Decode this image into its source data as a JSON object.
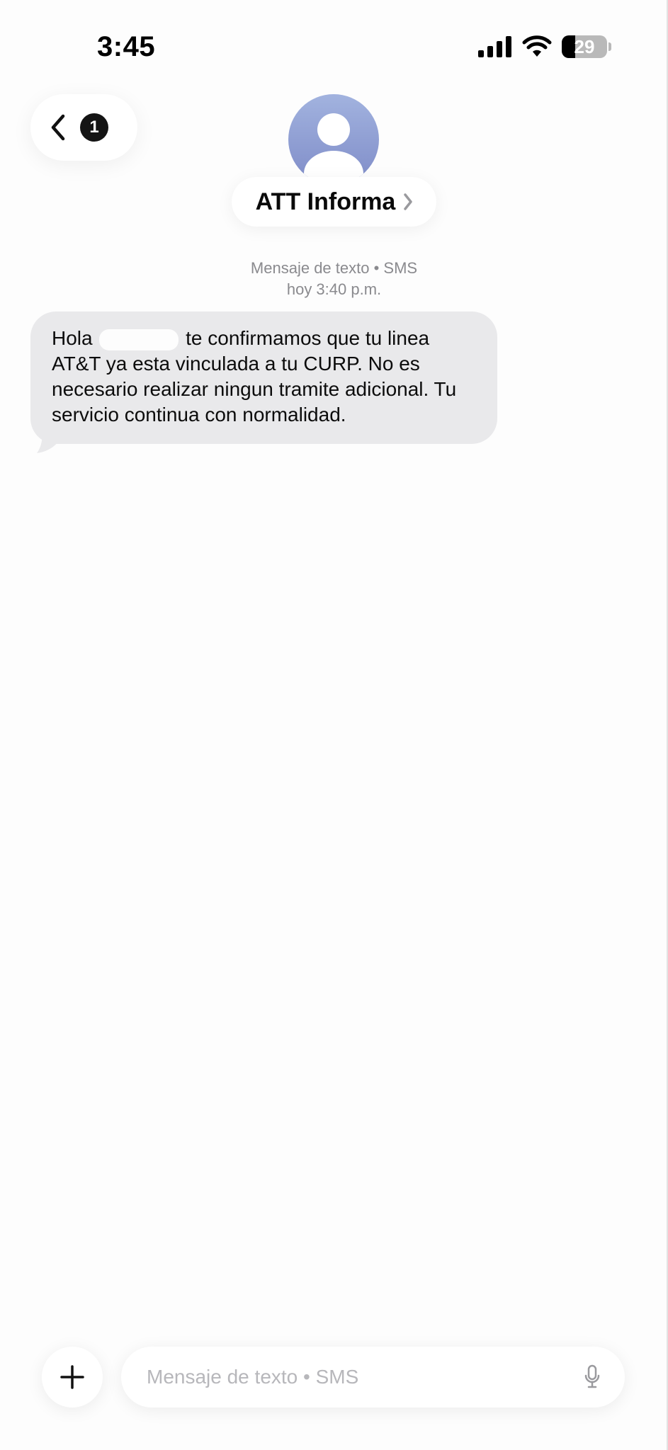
{
  "status_bar": {
    "time": "3:45",
    "battery_level": "29",
    "battery_fraction": 0.29
  },
  "header": {
    "back_badge_count": "1",
    "contact_name": "ATT Informa",
    "chevron_glyph": "›",
    "icons": [
      "chevron-left-icon",
      "contact-avatar-icon",
      "chevron-right-icon"
    ]
  },
  "conversation": {
    "service_label": "Mensaje de texto • SMS",
    "timestamp": "hoy 3:40 p.m.",
    "messages": [
      {
        "direction": "incoming",
        "text_before_redaction": "Hola",
        "text_after_redaction": "te confirmamos que tu linea AT&T ya esta vinculada a tu CURP. No es necesario realizar ningun tramite adicional. Tu servicio continua con normalidad."
      }
    ]
  },
  "composer": {
    "placeholder": "Mensaje de texto • SMS",
    "value": "",
    "icons": [
      "plus-icon",
      "microphone-icon"
    ]
  },
  "colors": {
    "incoming_bubble": "#e9e9eb",
    "avatar_gradient_top": "#a2b3df",
    "avatar_gradient_bottom": "#7f8cc8",
    "meta_text": "#8a8a8e",
    "placeholder_text": "#b7b7bb"
  }
}
